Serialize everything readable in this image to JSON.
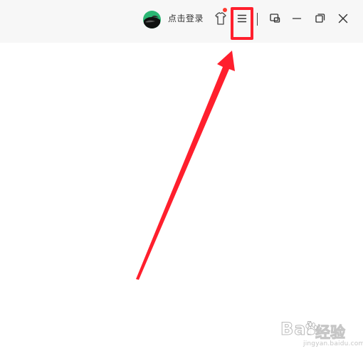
{
  "titlebar": {
    "login_label": "点击登录"
  },
  "icons": {
    "avatar": "avatar-icon",
    "skin": "tshirt-icon",
    "menu": "hamburger-menu-icon",
    "mini_mode": "mini-mode-icon",
    "minimize": "minimize-icon",
    "restore": "restore-icon",
    "close": "close-icon"
  },
  "watermark": {
    "brand_latin": "Bai",
    "brand_chinese": "经验",
    "url": "jingyan.baidu.com"
  },
  "colors": {
    "titlebar_bg": "#f7f7f7",
    "annotation_red": "#ff1f2d",
    "badge_red": "#ff3b30",
    "avatar_green": "#2bb673"
  }
}
